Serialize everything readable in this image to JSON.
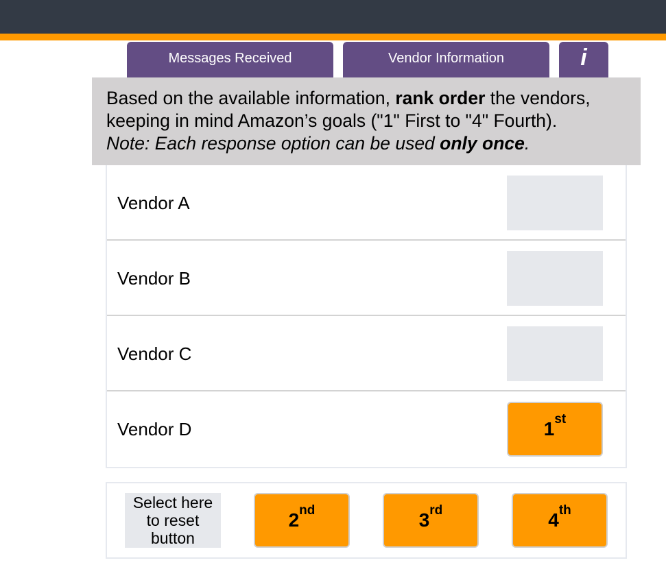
{
  "header": {
    "brand_color": "#333a45",
    "accent_color": "#ff9900"
  },
  "tabs": [
    {
      "label": "Messages Received"
    },
    {
      "label": "Vendor Information"
    },
    {
      "label": "i",
      "icon": "info-icon"
    }
  ],
  "tab_color": "#634d84",
  "instructions": {
    "line1_pre": "Based on the available information, ",
    "line1_bold": "rank order",
    "line1_post": " the vendors,",
    "line2": "keeping in mind Amazon’s goals (\"1\" First to \"4\" Fourth).",
    "line3_pre": "Note: Each response option can be used ",
    "line3_bold": "only once",
    "line3_post": "."
  },
  "vendors": [
    {
      "label": "Vendor A",
      "rank": null
    },
    {
      "label": "Vendor B",
      "rank": null
    },
    {
      "label": "Vendor C",
      "rank": null
    },
    {
      "label": "Vendor D",
      "rank": {
        "num": "1",
        "suffix": "st"
      }
    }
  ],
  "bank": {
    "reset_label": "Select here to reset button",
    "reset_lines": [
      "Select here",
      "to reset",
      "button"
    ],
    "options": [
      {
        "num": "2",
        "suffix": "nd"
      },
      {
        "num": "3",
        "suffix": "rd"
      },
      {
        "num": "4",
        "suffix": "th"
      }
    ]
  },
  "option_color": "#ff9900"
}
